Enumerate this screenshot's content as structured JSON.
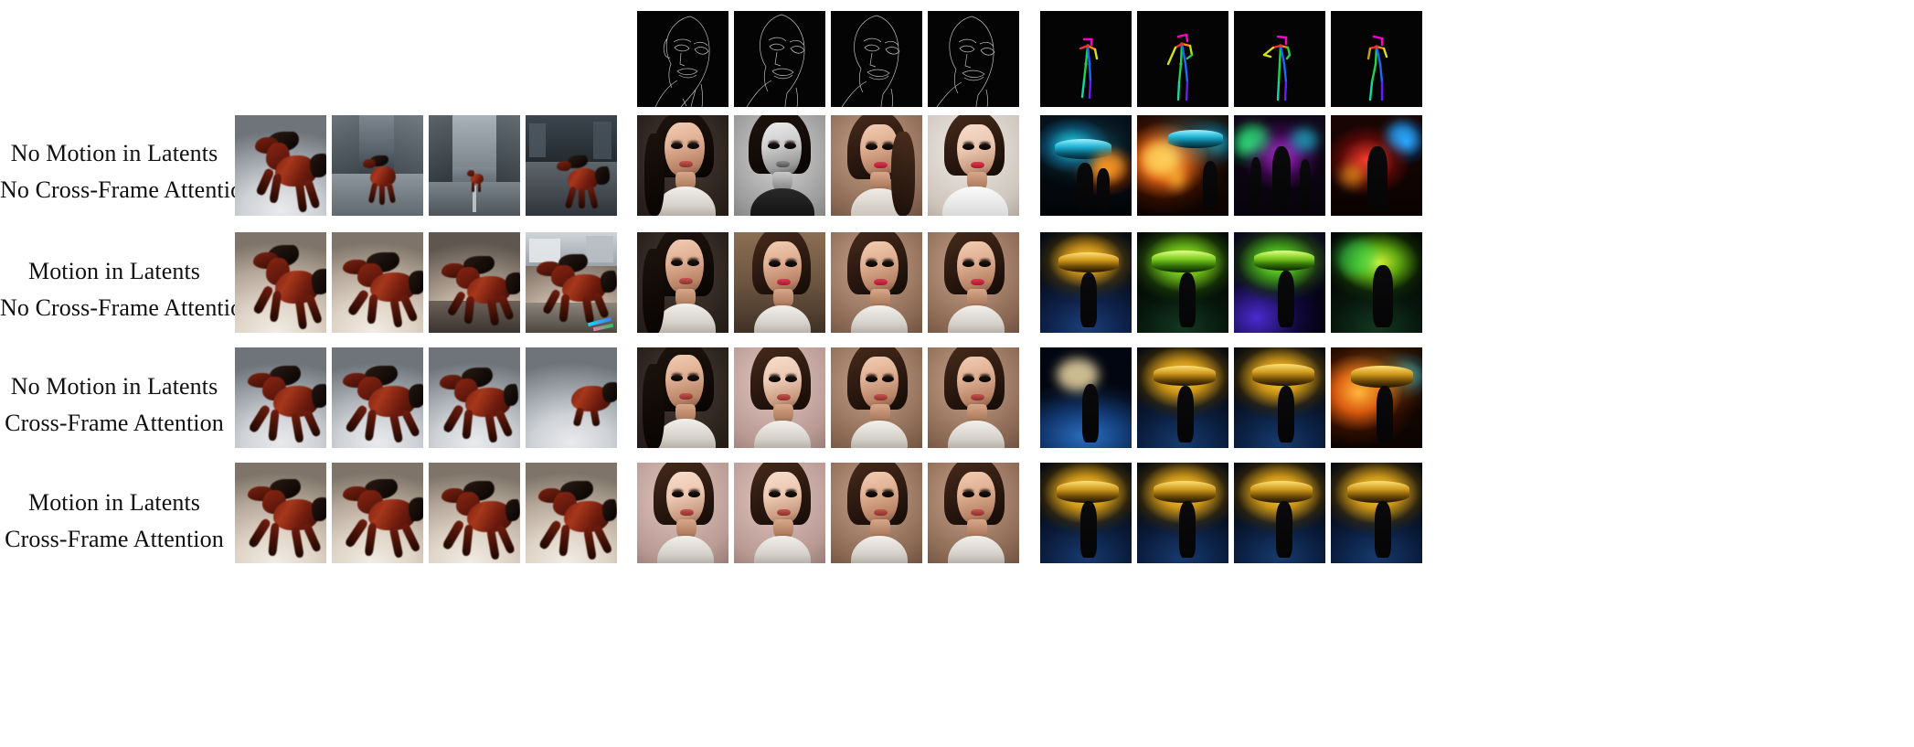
{
  "figure": {
    "background_color": "#ffffff",
    "text_color": "#101010",
    "rows": 4,
    "columns_per_group": 4,
    "groups": 3
  },
  "row_labels": [
    {
      "line1": "No Motion in Latents",
      "line2": "No Cross-Frame Attention"
    },
    {
      "line1": "Motion in Latents",
      "line2": "No Cross-Frame Attention"
    },
    {
      "line1": "No Motion in Latents",
      "line2": "Cross-Frame Attention"
    },
    {
      "line1": "Motion in Latents",
      "line2": "Cross-Frame Attention"
    }
  ],
  "control_strip": {
    "groups": [
      {
        "name": "horse-group-control",
        "type": "none",
        "frames": []
      },
      {
        "name": "face-group-control",
        "type": "canny-edge-map",
        "frames": [
          "canny-face-frame-1",
          "canny-face-frame-2",
          "canny-face-frame-3",
          "canny-face-frame-4"
        ],
        "line_color": "#b9b9b9",
        "background_color": "#000000"
      },
      {
        "name": "dancer-group-control",
        "type": "openpose-skeleton",
        "frames": [
          "pose-dancer-frame-1",
          "pose-dancer-frame-2",
          "pose-dancer-frame-3",
          "pose-dancer-frame-4"
        ],
        "background_color": "#000000",
        "joint_colors": [
          "#ff00c8",
          "#ff2a2a",
          "#ff8a00",
          "#d4e21a",
          "#22d44a",
          "#1ad4a8",
          "#1a6aff",
          "#6a1aff"
        ]
      }
    ]
  },
  "groups": [
    {
      "name": "horse-group",
      "subject": "galloping brown horse",
      "rows": [
        {
          "frames": [
            {
              "name": "horse-r1-f1",
              "caption": "brown horse rearing, grey sky"
            },
            {
              "name": "horse-r1-f2",
              "caption": "horse on city street, buildings"
            },
            {
              "name": "horse-r1-f3",
              "caption": "distant horse on empty street"
            },
            {
              "name": "horse-r1-f4",
              "caption": "horse at dusk, dark street"
            }
          ]
        },
        {
          "frames": [
            {
              "name": "horse-r2-f1",
              "caption": "brown horse rearing, warm haze"
            },
            {
              "name": "horse-r2-f2",
              "caption": "brown horse galloping, warm haze"
            },
            {
              "name": "horse-r2-f3",
              "caption": "horse on road at dusk"
            },
            {
              "name": "horse-r2-f4",
              "caption": "horse on street with bus, colored marks"
            }
          ]
        },
        {
          "frames": [
            {
              "name": "horse-r3-f1",
              "caption": "horse galloping, grey sky"
            },
            {
              "name": "horse-r3-f2",
              "caption": "horse galloping, grey sky"
            },
            {
              "name": "horse-r3-f3",
              "caption": "horse galloping, grey sky"
            },
            {
              "name": "horse-r3-f4",
              "caption": "horse partly out of frame, grey sky"
            }
          ]
        },
        {
          "frames": [
            {
              "name": "horse-r4-f1",
              "caption": "horse galloping, warm haze"
            },
            {
              "name": "horse-r4-f2",
              "caption": "horse galloping, warm haze"
            },
            {
              "name": "horse-r4-f3",
              "caption": "horse galloping, warm haze"
            },
            {
              "name": "horse-r4-f4",
              "caption": "horse galloping, warm haze"
            }
          ]
        }
      ]
    },
    {
      "name": "face-group",
      "subject": "woman portrait with makeup",
      "rows": [
        {
          "frames": [
            {
              "name": "face-r1-f1",
              "caption": "woman portrait, dark background"
            },
            {
              "name": "face-r1-f2",
              "caption": "woman portrait, black and white"
            },
            {
              "name": "face-r1-f3",
              "caption": "woman portrait, warm brown background"
            },
            {
              "name": "face-r1-f4",
              "caption": "woman portrait, light background"
            }
          ]
        },
        {
          "frames": [
            {
              "name": "face-r2-f1",
              "caption": "woman portrait, dark background"
            },
            {
              "name": "face-r2-f2",
              "caption": "woman portrait, brick background"
            },
            {
              "name": "face-r2-f3",
              "caption": "woman portrait, warm background"
            },
            {
              "name": "face-r2-f4",
              "caption": "woman portrait, brown background"
            }
          ]
        },
        {
          "frames": [
            {
              "name": "face-r3-f1",
              "caption": "woman portrait, dark background"
            },
            {
              "name": "face-r3-f2",
              "caption": "woman portrait, pink background"
            },
            {
              "name": "face-r3-f3",
              "caption": "woman portrait, warm background"
            },
            {
              "name": "face-r3-f4",
              "caption": "woman portrait, warm background"
            }
          ]
        },
        {
          "frames": [
            {
              "name": "face-r4-f1",
              "caption": "woman portrait, pink background"
            },
            {
              "name": "face-r4-f2",
              "caption": "woman portrait, pink background"
            },
            {
              "name": "face-r4-f3",
              "caption": "woman portrait, warm background"
            },
            {
              "name": "face-r4-f4",
              "caption": "woman portrait, warm background"
            }
          ]
        }
      ]
    },
    {
      "name": "dancer-group",
      "subject": "dancer under neon lights / flying saucer stage",
      "rows": [
        {
          "frames": [
            {
              "name": "dancer-r1-f1",
              "caption": "dancer, teal and orange neon"
            },
            {
              "name": "dancer-r1-f2",
              "caption": "stage with orange glow and saucer"
            },
            {
              "name": "dancer-r1-f3",
              "caption": "dancers, purple and green neon"
            },
            {
              "name": "dancer-r1-f4",
              "caption": "dancer, red neon stage"
            }
          ]
        },
        {
          "frames": [
            {
              "name": "dancer-r2-f1",
              "caption": "saucer over blue stage, dancer"
            },
            {
              "name": "dancer-r2-f2",
              "caption": "green saucer, dancer"
            },
            {
              "name": "dancer-r2-f3",
              "caption": "violet stage, green saucer, dancer"
            },
            {
              "name": "dancer-r2-f4",
              "caption": "green stage, dancer"
            }
          ]
        },
        {
          "frames": [
            {
              "name": "dancer-r3-f1",
              "caption": "blue stage, light burst, dancer"
            },
            {
              "name": "dancer-r3-f2",
              "caption": "gold saucer over blue stage, dancer"
            },
            {
              "name": "dancer-r3-f3",
              "caption": "gold saucer, dancer"
            },
            {
              "name": "dancer-r3-f4",
              "caption": "orange saucer glow, dancer"
            }
          ]
        },
        {
          "frames": [
            {
              "name": "dancer-r4-f1",
              "caption": "gold saucer over blue stage, dancer"
            },
            {
              "name": "dancer-r4-f2",
              "caption": "gold saucer over blue stage, dancer"
            },
            {
              "name": "dancer-r4-f3",
              "caption": "gold saucer over blue stage, dancer"
            },
            {
              "name": "dancer-r4-f4",
              "caption": "gold saucer over blue stage, dancer"
            }
          ]
        }
      ]
    }
  ]
}
